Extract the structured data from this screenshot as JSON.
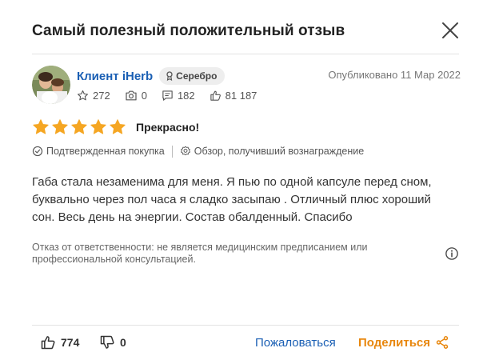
{
  "modal": {
    "title": "Самый полезный положительный отзыв",
    "close_icon": "close-icon"
  },
  "author": {
    "name": "Клиент iHerb",
    "badge": "Серебро",
    "published": "Опубликовано 11 Мар 2022",
    "stats": {
      "favorites": "272",
      "photos": "0",
      "reviews": "182",
      "helpful": "81 187"
    }
  },
  "review": {
    "stars": 5,
    "max_stars": 5,
    "star_color": "#f5a623",
    "title": "Прекрасно!",
    "verified_label": "Подтвержденная покупка",
    "rewarded_label": "Обзор, получивший вознаграждение",
    "text": "Габа стала незаменима для меня. Я пью по одной капсуле перед сном, буквально через пол часа я сладко засыпаю . Отличный плюс хороший сон. Весь день на энергии. Состав обалденный. Спасибо",
    "disclaimer": "Отказ от ответственности: не является медицинским предписанием или профессиональной консультацией."
  },
  "footer": {
    "helpful_count": "774",
    "unhelpful_count": "0",
    "report_label": "Пожаловаться",
    "share_label": "Поделиться"
  },
  "colors": {
    "link": "#1a5fb4",
    "share": "#e8870e",
    "star": "#f5a623"
  }
}
